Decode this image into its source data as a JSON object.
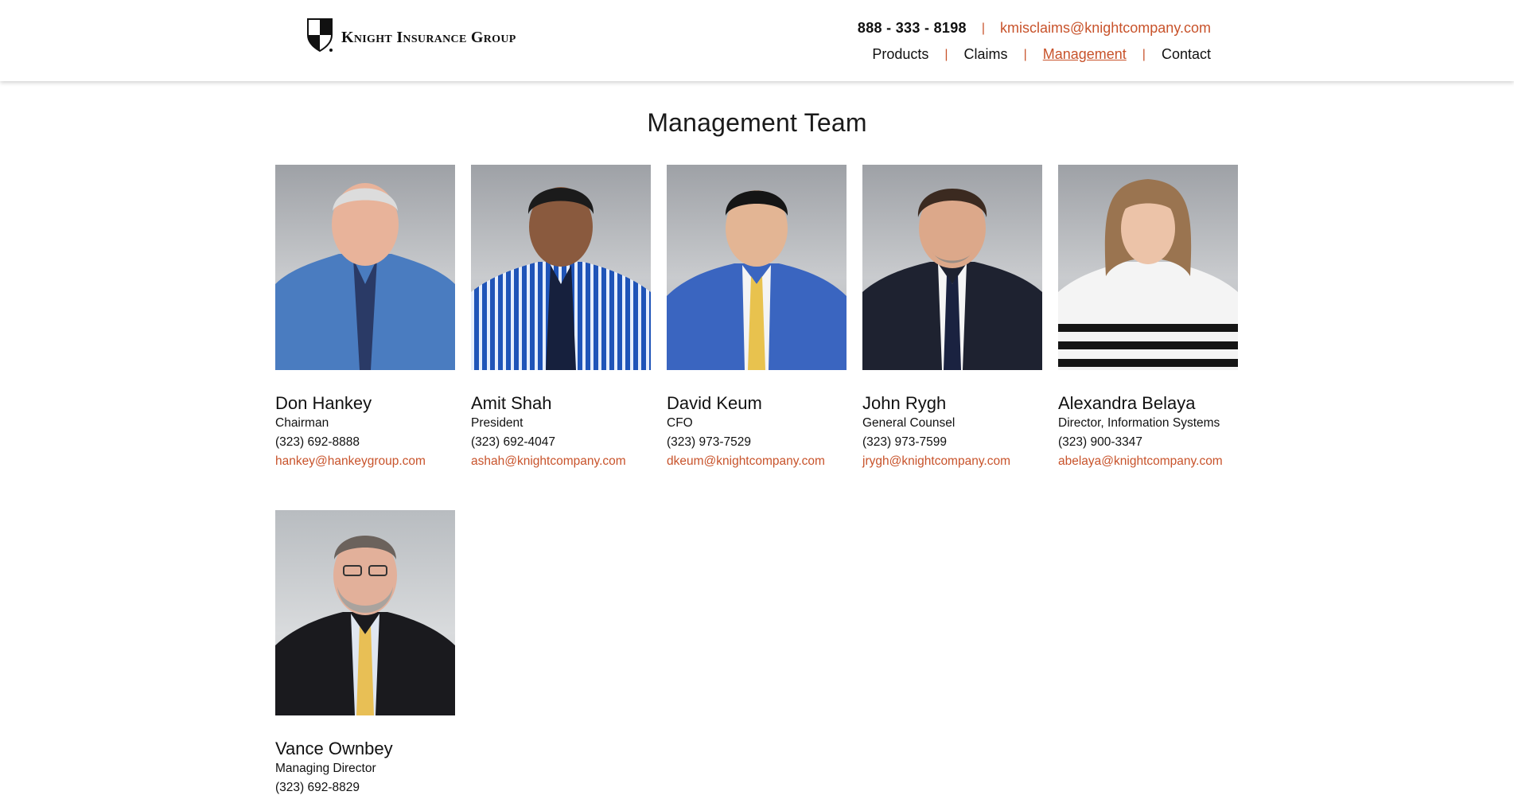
{
  "header": {
    "logo_text": "Knight Insurance Group",
    "phone": "888 - 333 - 8198",
    "separator": "|",
    "email": "kmisclaims@knightcompany.com",
    "nav": [
      {
        "label": "Products",
        "active": false
      },
      {
        "label": "Claims",
        "active": false
      },
      {
        "label": "Management",
        "active": true
      },
      {
        "label": "Contact",
        "active": false
      }
    ]
  },
  "main": {
    "title": "Management Team",
    "team": [
      {
        "name": "Don Hankey",
        "role": "Chairman",
        "phone": "(323) 692-8888",
        "email": "hankey@hankeygroup.com",
        "photo": "portrait-don-hankey"
      },
      {
        "name": "Amit Shah",
        "role": "President",
        "phone": "(323) 692-4047",
        "email": "ashah@knightcompany.com",
        "photo": "portrait-amit-shah"
      },
      {
        "name": "David Keum",
        "role": "CFO",
        "phone": "(323) 973-7529",
        "email": "dkeum@knightcompany.com",
        "photo": "portrait-david-keum"
      },
      {
        "name": "John Rygh",
        "role": "General Counsel",
        "phone": "(323) 973-7599",
        "email": "jrygh@knightcompany.com",
        "photo": "portrait-john-rygh"
      },
      {
        "name": "Alexandra Belaya",
        "role": "Director, Information Systems",
        "phone": "(323) 900-3347",
        "email": "abelaya@knightcompany.com",
        "photo": "portrait-alexandra-belaya"
      },
      {
        "name": "Vance Ownbey",
        "role": "Managing Director",
        "phone": "(323) 692-8829",
        "email": "",
        "photo": "portrait-vance-ownbey"
      }
    ]
  },
  "colors": {
    "accent": "#c8532b",
    "text": "#111111"
  }
}
